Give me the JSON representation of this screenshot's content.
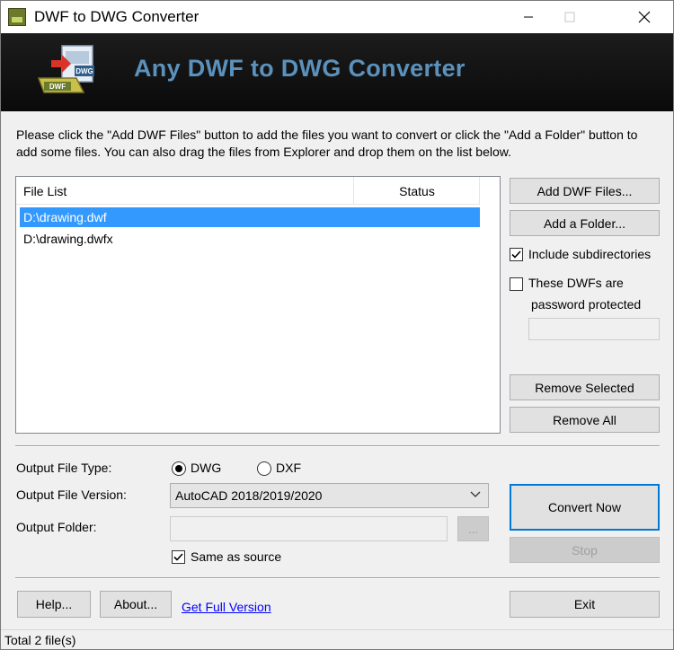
{
  "window": {
    "title": "DWF to DWG Converter",
    "minimize_icon": "minimize-icon",
    "maximize_icon": "maximize-icon",
    "close_icon": "close-icon"
  },
  "banner": {
    "title": "Any DWF to DWG Converter",
    "title_color": "#5b91bb",
    "logo_icon": "dwf-to-dwg-logo-icon",
    "logo_label_dwf": "DWF",
    "logo_label_dwg": "DWG"
  },
  "intro": {
    "text": "Please click the \"Add DWF Files\" button to add the files you want to convert or click the \"Add a Folder\" button to add some files. You can also drag the files from Explorer and drop them on the list below."
  },
  "file_list": {
    "columns": [
      "File List",
      "Status"
    ],
    "rows": [
      {
        "name": "D:\\drawing.dwf",
        "status": "",
        "selected": true
      },
      {
        "name": "D:\\drawing.dwfx",
        "status": "",
        "selected": false
      }
    ]
  },
  "side_panel": {
    "add_files_label": "Add DWF Files...",
    "add_folder_label": "Add a Folder...",
    "include_subdirs_label": "Include subdirectories",
    "include_subdirs_checked": true,
    "password_label_line1": "These DWFs are",
    "password_label_line2": "password protected",
    "password_checked": false,
    "password_value": "",
    "remove_selected_label": "Remove Selected",
    "remove_all_label": "Remove All"
  },
  "output": {
    "type_label": "Output File Type:",
    "type_options": [
      "DWG",
      "DXF"
    ],
    "type_selected": "DWG",
    "version_label": "Output File Version:",
    "version_value": "AutoCAD 2018/2019/2020",
    "folder_label": "Output Folder:",
    "folder_value": "",
    "browse_label": "...",
    "same_as_source_label": "Same as source",
    "same_as_source_checked": true
  },
  "actions": {
    "convert_label": "Convert Now",
    "stop_label": "Stop",
    "help_label": "Help...",
    "about_label": "About...",
    "full_version_link": "Get Full Version",
    "exit_label": "Exit"
  },
  "status_bar": {
    "text": "Total 2 file(s)"
  }
}
